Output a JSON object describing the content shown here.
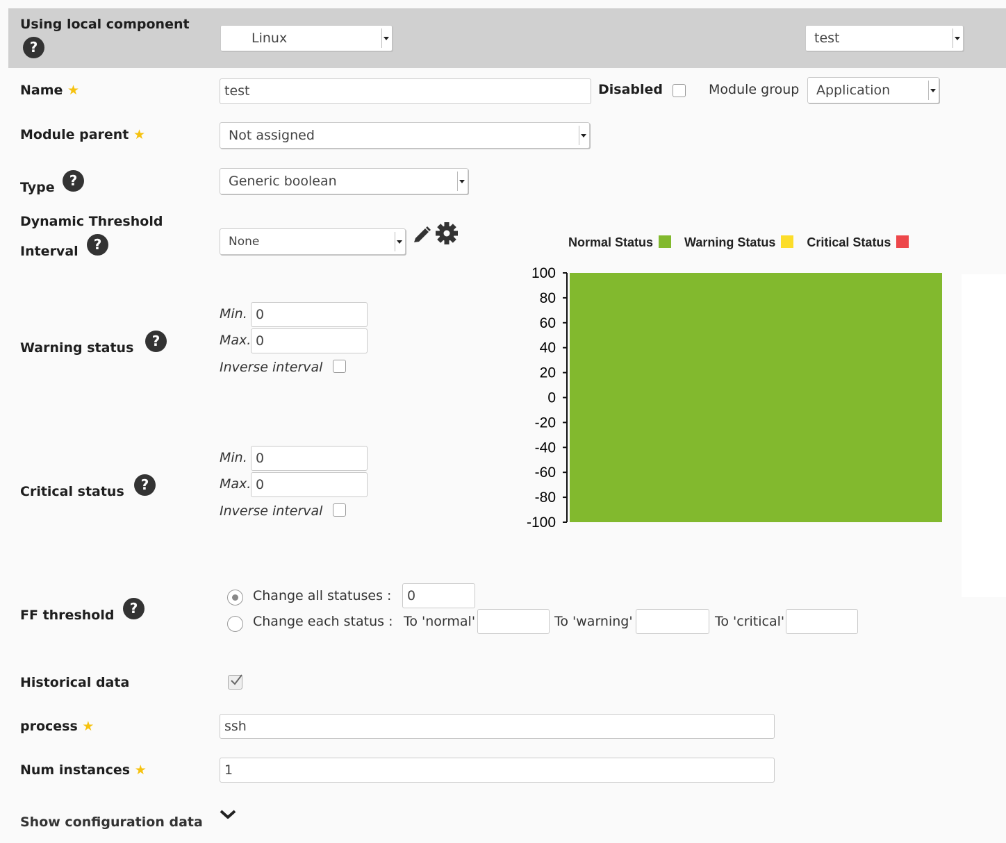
{
  "header": {
    "using_local_component_label": "Using local component",
    "os_select": "Linux",
    "component_select": "test"
  },
  "form": {
    "name_label": "Name",
    "name_value": "test",
    "disabled_label": "Disabled",
    "module_group_label": "Module group",
    "module_group_value": "Application",
    "module_parent_label": "Module parent",
    "module_parent_value": "Not assigned",
    "type_label": "Type",
    "type_value": "Generic boolean",
    "dyn_threshold_label_1": "Dynamic Threshold",
    "dyn_threshold_label_2": "Interval",
    "dyn_threshold_value": "None",
    "warning_label": "Warning status",
    "warning_min_label": "Min.",
    "warning_min_value": "0",
    "warning_max_label": "Max.",
    "warning_max_value": "0",
    "warning_inverse_label": "Inverse interval",
    "critical_label": "Critical status",
    "critical_min_label": "Min.",
    "critical_min_value": "0",
    "critical_max_label": "Max.",
    "critical_max_value": "0",
    "critical_inverse_label": "Inverse interval",
    "ff_label": "FF threshold",
    "ff_change_all_label": "Change all statuses :",
    "ff_change_all_value": "0",
    "ff_change_each_label": "Change each status :",
    "ff_to_normal_label": "To 'normal'",
    "ff_to_warning_label": "To 'warning'",
    "ff_to_critical_label": "To 'critical'",
    "historical_label": "Historical data",
    "process_label": "process",
    "process_value": "ssh",
    "num_instances_label": "Num instances",
    "num_instances_value": "1",
    "show_config_label": "Show configuration data"
  },
  "icons": {
    "help": "?",
    "star": "★",
    "pencil": "pencil-icon",
    "gear": "gear-icon",
    "chevron": "chevron-down-icon"
  },
  "chart_data": {
    "type": "area",
    "legend": [
      {
        "name": "Normal Status",
        "color": "#82b92e"
      },
      {
        "name": "Warning Status",
        "color": "#fcdd2a"
      },
      {
        "name": "Critical Status",
        "color": "#ed474a"
      }
    ],
    "legend_position": "top",
    "ylim": [
      -100,
      100
    ],
    "yticks": [
      "100",
      "80",
      "60",
      "40",
      "20",
      "0",
      "-20",
      "-40",
      "-60",
      "-80",
      "-100"
    ],
    "regions": [
      {
        "status": "Normal Status",
        "from": -100,
        "to": 100,
        "color": "#82b92e"
      }
    ]
  }
}
